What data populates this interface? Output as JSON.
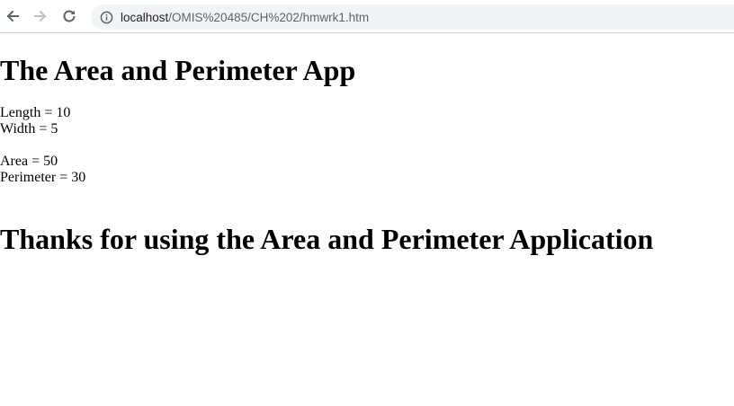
{
  "browser": {
    "back_icon": "arrow-left-icon",
    "forward_icon": "arrow-right-icon",
    "reload_icon": "reload-icon",
    "info_icon": "info-icon",
    "url_host": "localhost",
    "url_path": "/OMIS%20485/CH%202/hmwrk1.htm"
  },
  "page": {
    "title": "The Area and Perimeter App",
    "length_line": "Length = 10",
    "width_line": "Width = 5",
    "area_line": "Area = 50",
    "perimeter_line": "Perimeter = 30",
    "thanks": "Thanks for using the Area and Perimeter Application"
  }
}
